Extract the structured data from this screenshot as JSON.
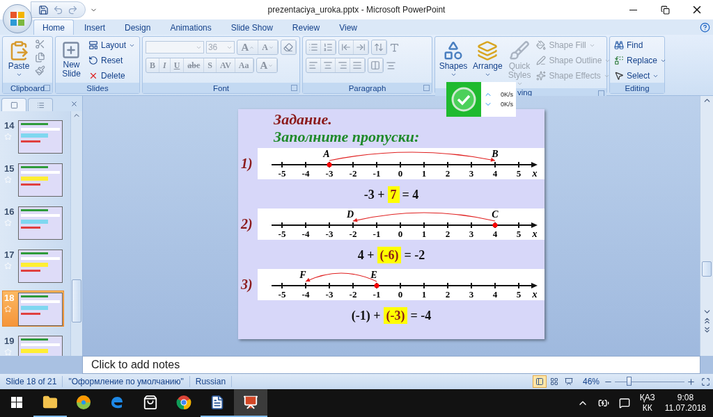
{
  "window": {
    "title": "prezentaciya_uroka.pptx - Microsoft PowerPoint"
  },
  "tabs": [
    {
      "label": "Home",
      "selected": true
    },
    {
      "label": "Insert",
      "selected": false
    },
    {
      "label": "Design",
      "selected": false
    },
    {
      "label": "Animations",
      "selected": false
    },
    {
      "label": "Slide Show",
      "selected": false
    },
    {
      "label": "Review",
      "selected": false
    },
    {
      "label": "View",
      "selected": false
    }
  ],
  "ribbon": {
    "groups": [
      {
        "kind": "clipboard",
        "label": "Clipboard",
        "paste": "Paste"
      },
      {
        "kind": "slides",
        "label": "Slides",
        "new_slide": "New Slide",
        "items": [
          {
            "label": "Layout",
            "dropdown": true
          },
          {
            "label": "Reset",
            "dropdown": false
          },
          {
            "label": "Delete",
            "dropdown": false
          }
        ]
      },
      {
        "kind": "font",
        "label": "Font",
        "disabled": true,
        "font_size": "36",
        "size_buttons": [
          "A",
          "A"
        ],
        "glyphs": [
          "B",
          "I",
          "U",
          "abc",
          "S",
          "AV",
          "Aa",
          "A"
        ]
      },
      {
        "kind": "paragraph",
        "label": "Paragraph",
        "disabled": true
      },
      {
        "kind": "drawing",
        "label": "ving",
        "items": [
          {
            "label": "Shapes",
            "disabled": false
          },
          {
            "label": "Arrange",
            "disabled": false
          },
          {
            "label": "Quick Styles",
            "disabled": true
          }
        ],
        "format_items": [
          {
            "label": "Shape Fill",
            "disabled": true
          },
          {
            "label": "Shape Outline",
            "disabled": true
          },
          {
            "label": "Shape Effects",
            "disabled": true
          }
        ]
      },
      {
        "kind": "editing",
        "label": "Editing",
        "items": [
          {
            "label": "Find",
            "dropdown": false
          },
          {
            "label": "Replace",
            "dropdown": true
          },
          {
            "label": "Select",
            "dropdown": true
          }
        ]
      }
    ]
  },
  "speed_widget": {
    "upload": "0K/s",
    "download": "0K/s"
  },
  "slides_panel": {
    "thumbnails": [
      {
        "number": "14",
        "selected": false
      },
      {
        "number": "15",
        "selected": false
      },
      {
        "number": "16",
        "selected": false
      },
      {
        "number": "17",
        "selected": false
      },
      {
        "number": "18",
        "selected": true
      },
      {
        "number": "19",
        "selected": false
      }
    ]
  },
  "slide": {
    "title": "Задание.",
    "subtitle": "Заполните пропуски:",
    "tasks": [
      {
        "label": "1)",
        "axis_label": "x",
        "ticks": [
          {
            "label": "-5"
          },
          {
            "label": "-4"
          },
          {
            "label": "-3",
            "point": {
              "name": "A",
              "dot": true
            }
          },
          {
            "label": "-2"
          },
          {
            "label": "-1"
          },
          {
            "label": "0"
          },
          {
            "label": "1"
          },
          {
            "label": "2"
          },
          {
            "label": "3"
          },
          {
            "label": "4",
            "point": {
              "name": "B",
              "dot": false
            }
          },
          {
            "label": "5"
          }
        ],
        "equation": [
          {
            "text": "-3 +",
            "highlight": false
          },
          {
            "text": "7",
            "highlight": true
          },
          {
            "text": "= 4",
            "highlight": false
          }
        ]
      },
      {
        "label": "2)",
        "axis_label": "x",
        "ticks": [
          {
            "label": "-5"
          },
          {
            "label": "-4"
          },
          {
            "label": "-3"
          },
          {
            "label": "-2",
            "point": {
              "name": "D",
              "dot": false
            }
          },
          {
            "label": "-1"
          },
          {
            "label": "0"
          },
          {
            "label": "1"
          },
          {
            "label": "2"
          },
          {
            "label": "3"
          },
          {
            "label": "4",
            "point": {
              "name": "C",
              "dot": true
            }
          },
          {
            "label": "5"
          }
        ],
        "equation": [
          {
            "text": "4 +",
            "highlight": false
          },
          {
            "text": "(-6)",
            "highlight": true
          },
          {
            "text": "= -2",
            "highlight": false
          }
        ]
      },
      {
        "label": "3)",
        "axis_label": "x",
        "ticks": [
          {
            "label": "-5"
          },
          {
            "label": "-4",
            "point": {
              "name": "F",
              "dot": false
            }
          },
          {
            "label": "-3"
          },
          {
            "label": "-2"
          },
          {
            "label": "-1",
            "point": {
              "name": "E",
              "dot": true
            }
          },
          {
            "label": "0"
          },
          {
            "label": "1"
          },
          {
            "label": "2"
          },
          {
            "label": "3"
          },
          {
            "label": "4"
          },
          {
            "label": "5"
          }
        ],
        "equation": [
          {
            "text": "(-1) +",
            "highlight": false
          },
          {
            "text": "(-3)",
            "highlight": true
          },
          {
            "text": "= -4",
            "highlight": false
          }
        ]
      }
    ]
  },
  "notes": {
    "placeholder": "Click to add notes"
  },
  "status_bar": {
    "slide": "Slide 18 of 21",
    "theme": "\"Оформление по умолчанию\"",
    "language": "Russian",
    "views": [
      {
        "selected": true
      },
      {
        "selected": false
      },
      {
        "selected": false
      }
    ],
    "zoom": "46%",
    "zoom_slider": {
      "level": 0.2
    }
  },
  "taskbar": {
    "apps": [
      {
        "kind": "explorer",
        "running": true,
        "active": false
      },
      {
        "kind": "disc",
        "running": false,
        "active": false
      },
      {
        "kind": "edge",
        "running": false,
        "active": false
      },
      {
        "kind": "store",
        "running": false,
        "active": false
      },
      {
        "kind": "chrome",
        "running": false,
        "active": false
      },
      {
        "kind": "word",
        "running": true,
        "active": false
      },
      {
        "kind": "powerpoint",
        "running": true,
        "active": true
      }
    ],
    "language": "ҚАЗ",
    "layout": "КК",
    "time": "9:08",
    "date": "11.07.2018"
  }
}
